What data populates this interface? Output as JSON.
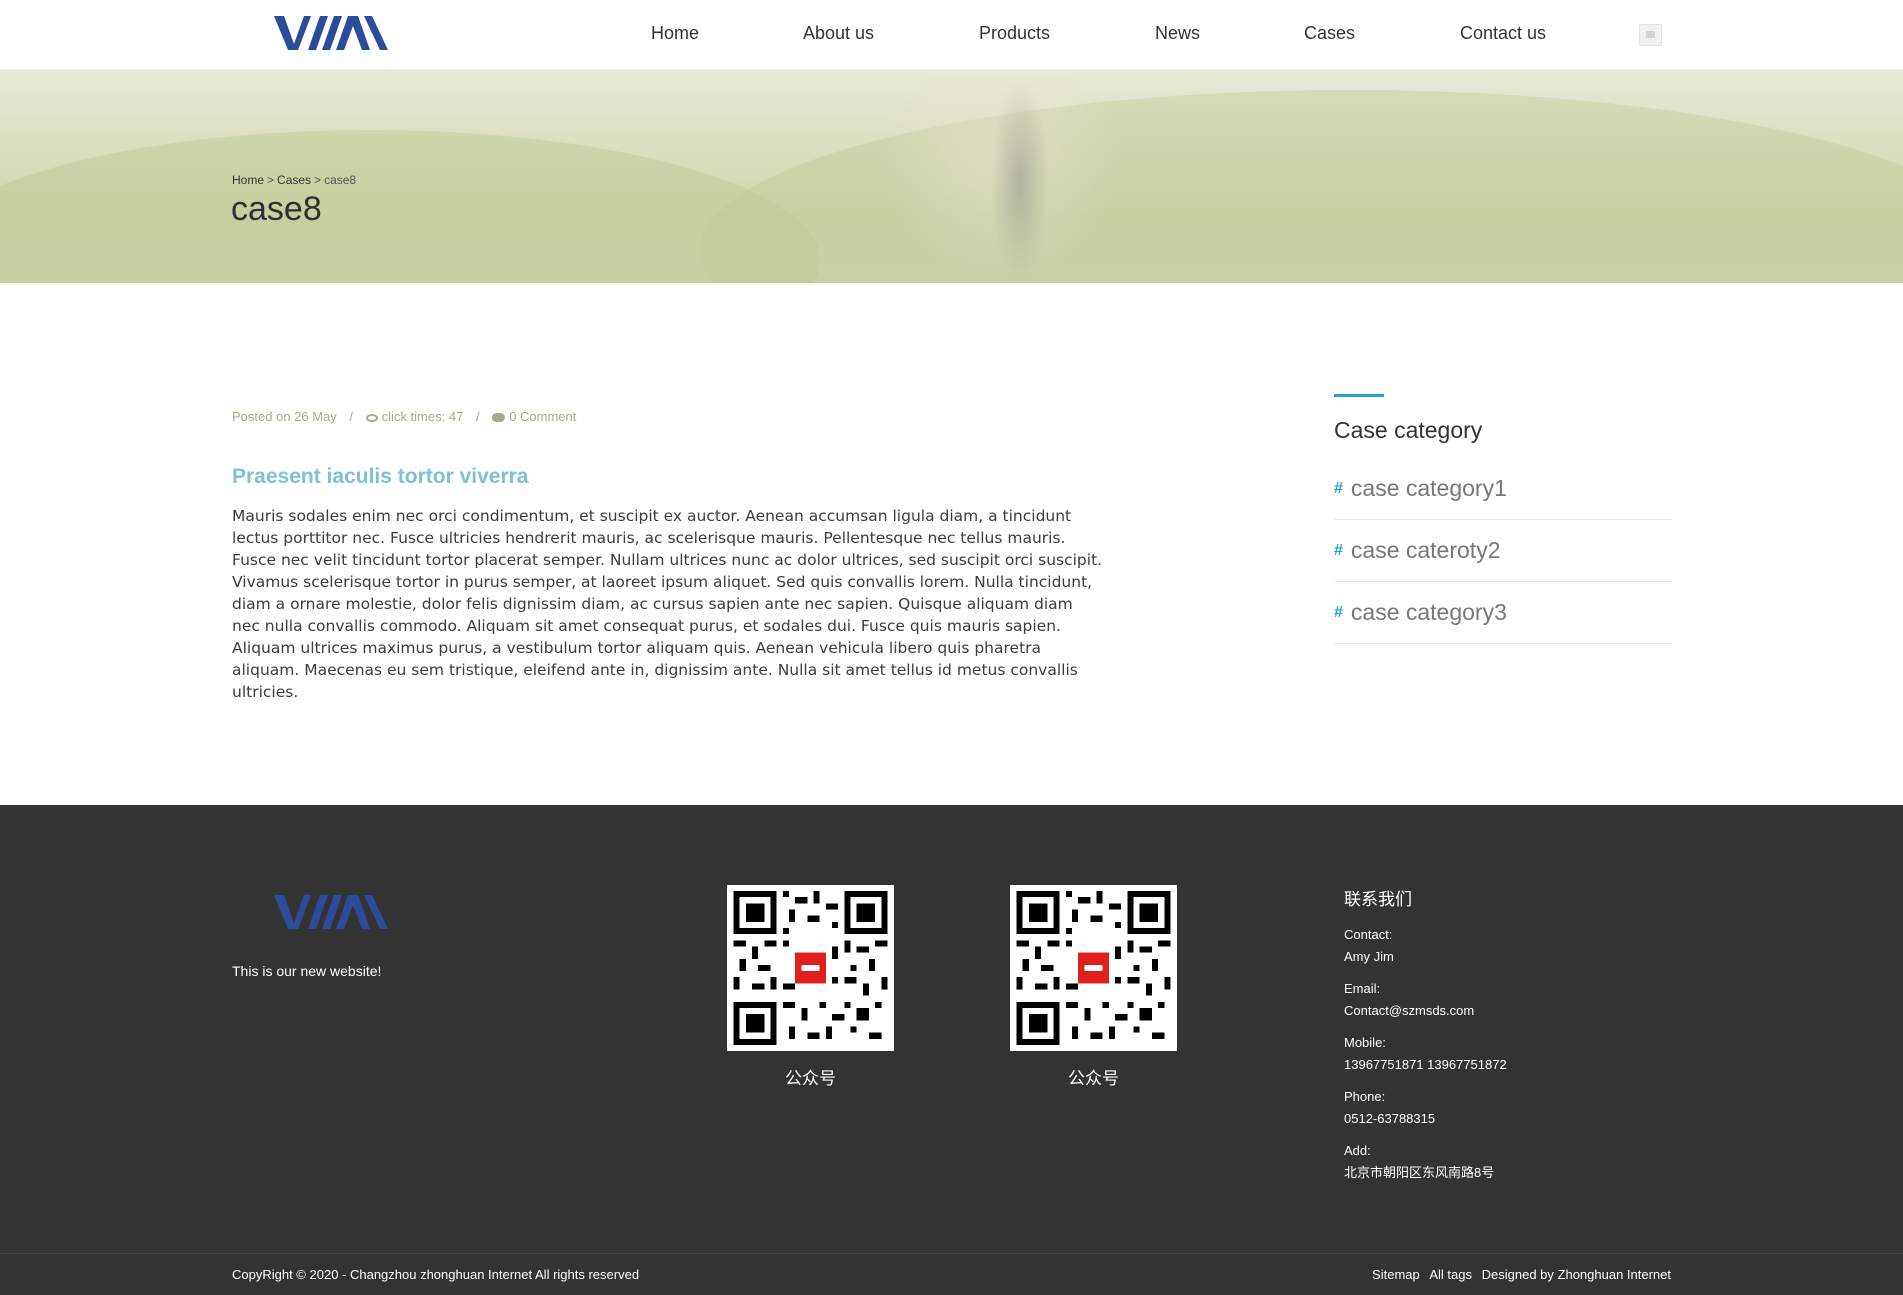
{
  "header": {
    "logo_text": "YHMA",
    "nav": [
      "Home",
      "About us",
      "Products",
      "News",
      "Cases",
      "Contact us"
    ]
  },
  "banner": {
    "breadcrumb": [
      "Home",
      "Cases",
      "case8"
    ],
    "breadcrumb_sep": ">",
    "title": "case8"
  },
  "article": {
    "meta": {
      "posted": "Posted on 26 May",
      "sep": "/",
      "clicks": "click times: 47",
      "comments": "0 Comment"
    },
    "title": "Praesent iaculis tortor viverra",
    "body": "Mauris sodales enim nec orci condimentum, et suscipit ex auctor. Aenean accumsan ligula diam, a tincidunt lectus porttitor nec. Fusce ultricies hendrerit mauris, ac scelerisque mauris. Pellentesque nec tellus mauris. Fusce nec velit tincidunt tortor placerat semper. Nullam ultrices nunc ac dolor ultrices, sed suscipit orci suscipit. Vivamus scelerisque tortor in purus semper, at laoreet ipsum aliquet. Sed quis convallis lorem. Nulla tincidunt, diam a ornare molestie, dolor felis dignissim diam, ac cursus sapien ante nec sapien. Quisque aliquam diam nec nulla convallis commodo. Aliquam sit amet consequat purus, et sodales dui. Fusce quis mauris sapien. Aliquam ultrices maximus purus, a vestibulum tortor aliquam quis. Aenean vehicula libero quis pharetra aliquam. Maecenas eu sem tristique, eleifend ante in, dignissim ante. Nulla sit amet tellus id metus convallis ultricies."
  },
  "sidebar": {
    "title": "Case category",
    "hash": "#",
    "items": [
      "case category1",
      "case cateroty2",
      "case category3"
    ]
  },
  "footer": {
    "tagline": "This is our new website!",
    "qr_labels": [
      "公众号",
      "公众号"
    ],
    "contact": {
      "title": "联系我们",
      "contact_label": "Contact:",
      "contact_value": "Amy  Jim",
      "email_label": "Email:",
      "email_value": "Contact@szmsds.com",
      "mobile_label": "Mobile:",
      "mobile_value": "13967751871  13967751872",
      "phone_label": "Phone:",
      "phone_value": "0512-63788315",
      "add_label": "Add:",
      "add_value": "北京市朝阳区东风南路8号"
    },
    "copyright": "CopyRight © 2020 -   Changzhou zhonghuan Internet  All rights reserved",
    "links": [
      "Sitemap",
      "All tags",
      "Designed by Zhonghuan Internet"
    ]
  },
  "colors": {
    "accent": "#2a9fd6",
    "logo_blue": "#2b4b9b",
    "article_title": "#7fc0d3",
    "footer_bg": "#333333"
  }
}
